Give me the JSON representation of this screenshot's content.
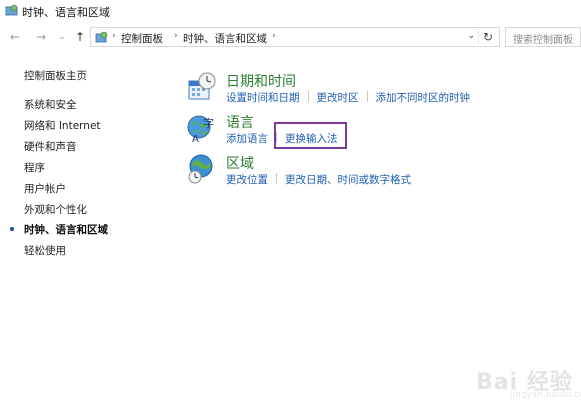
{
  "window": {
    "title": "时钟、语言和区域"
  },
  "navigation": {
    "back_icon": "arrow-left-icon",
    "forward_icon": "arrow-right-icon",
    "up_icon": "arrow-up-icon",
    "breadcrumb": [
      "控制面板",
      "时钟、语言和区域"
    ],
    "refresh_icon": "refresh-icon",
    "search_placeholder": "搜索控制面板"
  },
  "sidebar": {
    "items": [
      {
        "label": "控制面板主页",
        "active": false
      },
      {
        "label": "系统和安全",
        "active": false
      },
      {
        "label": "网络和 Internet",
        "active": false
      },
      {
        "label": "硬件和声音",
        "active": false
      },
      {
        "label": "程序",
        "active": false
      },
      {
        "label": "用户帐户",
        "active": false
      },
      {
        "label": "外观和个性化",
        "active": false
      },
      {
        "label": "时钟、语言和区域",
        "active": true
      },
      {
        "label": "轻松使用",
        "active": false
      }
    ]
  },
  "categories": [
    {
      "title": "日期和时间",
      "icon": "clock-calendar-icon",
      "links": [
        "设置时间和日期",
        "更改时区",
        "添加不同时区的时钟"
      ]
    },
    {
      "title": "语言",
      "icon": "language-icon",
      "links": [
        "添加语言",
        "更换输入法"
      ]
    },
    {
      "title": "区域",
      "icon": "globe-clock-icon",
      "links": [
        "更改位置",
        "更改日期、时间或数字格式"
      ]
    }
  ],
  "highlighted_link": "更换输入法",
  "colors": {
    "category_title": "#2a7e33",
    "link": "#1f5fb0",
    "highlight_border": "#7d3a9c"
  },
  "watermark": {
    "text": "Bai 经验",
    "sub": "jingyan.baidu.com"
  }
}
